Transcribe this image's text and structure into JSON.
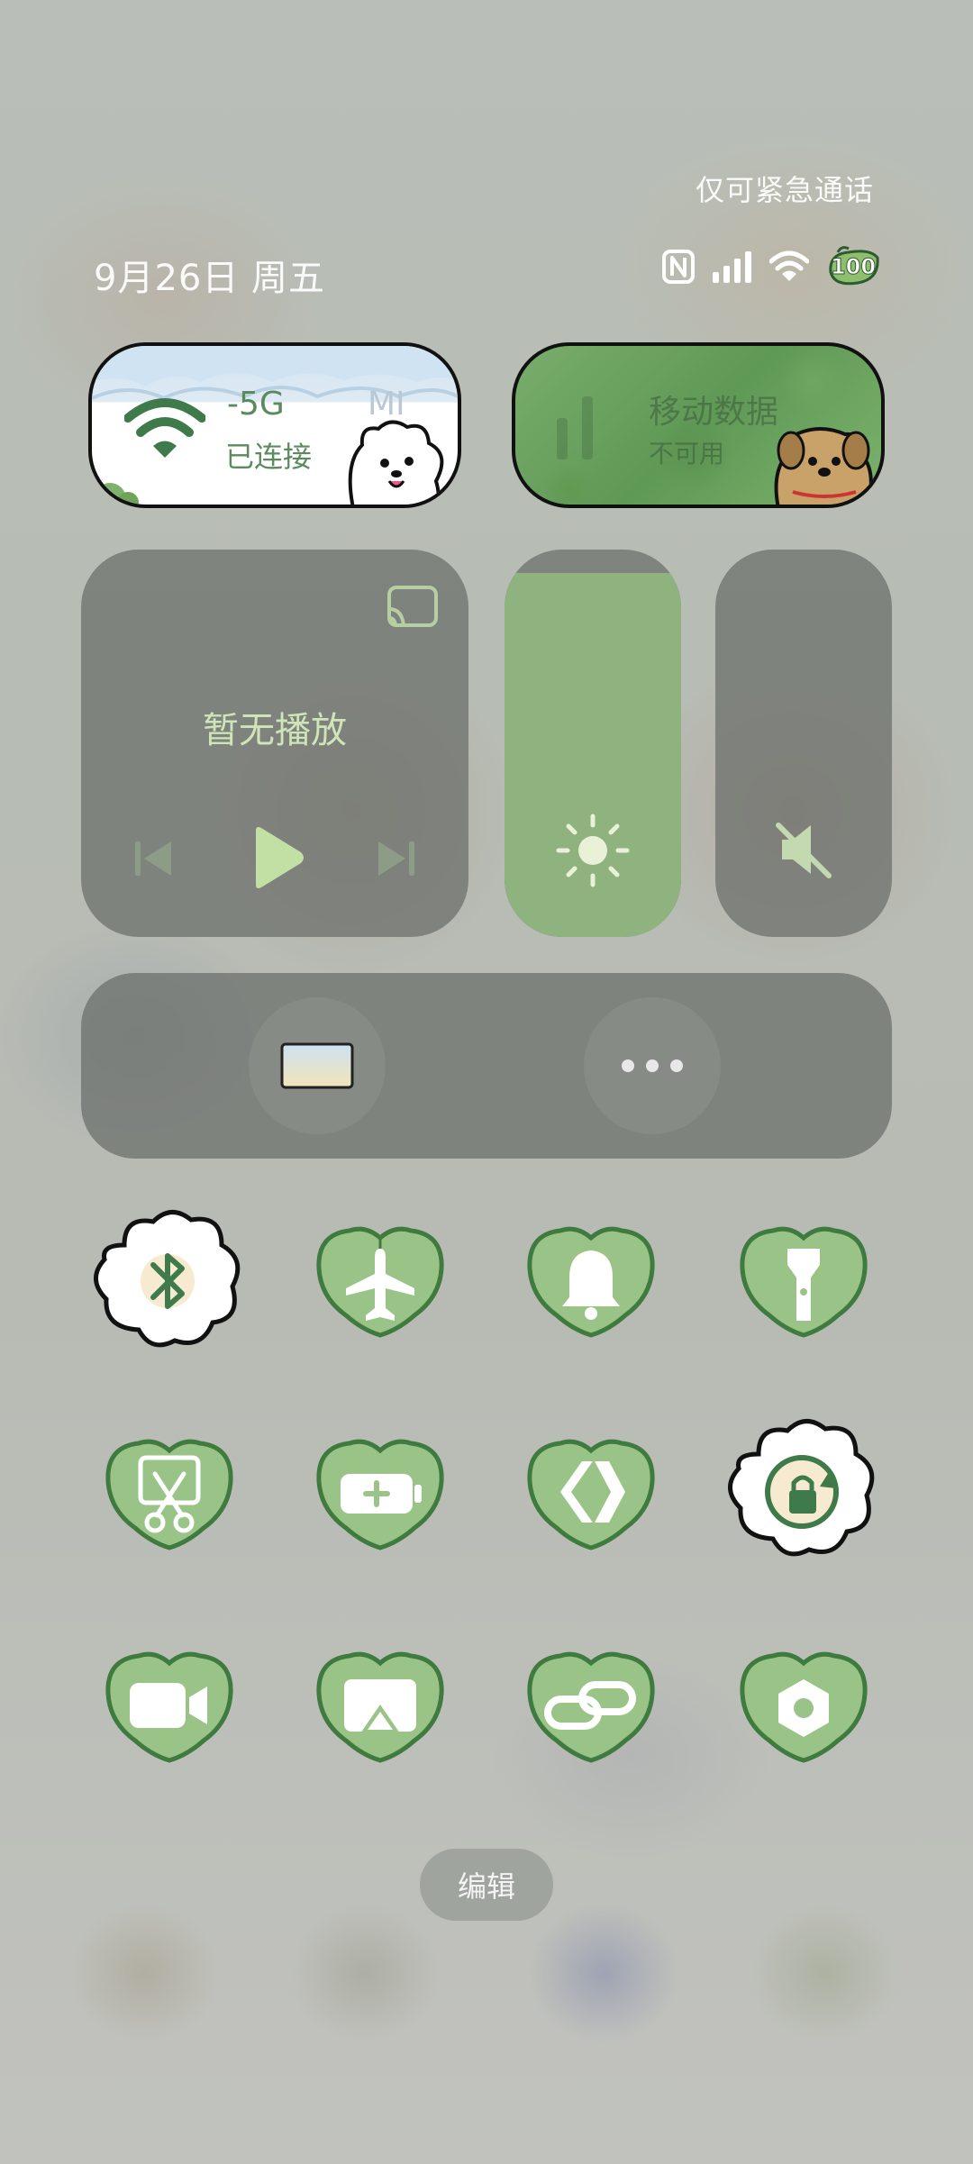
{
  "status": {
    "emergency_text": "仅可紧急通话",
    "date": "9月26日 周五",
    "battery_level": "100",
    "icons": [
      "nfc-icon",
      "signal-icon",
      "wifi-icon",
      "battery-icon"
    ]
  },
  "wifi_tile": {
    "network_name": "-5G",
    "network_trailing": "MI",
    "status": "已连接",
    "icon": "wifi-icon"
  },
  "data_tile": {
    "title": "移动数据",
    "status": "不可用"
  },
  "media": {
    "title": "暂无播放",
    "controls": [
      "previous-icon",
      "play-icon",
      "next-icon"
    ],
    "cast_icon": "cast-icon"
  },
  "brightness": {
    "level_fraction": 0.94,
    "icon": "sun-icon"
  },
  "volume": {
    "muted": true,
    "icon": "mute-icon"
  },
  "shortcuts": {
    "left_icon": "wallpaper-icon",
    "right_icon": "more-icon"
  },
  "toggles": [
    {
      "name": "bluetooth",
      "icon": "bluetooth-icon",
      "active": true
    },
    {
      "name": "airplane",
      "icon": "airplane-icon",
      "active": false
    },
    {
      "name": "ring",
      "icon": "bell-icon",
      "active": false
    },
    {
      "name": "flashlight",
      "icon": "flashlight-icon",
      "active": false
    },
    {
      "name": "screenshot",
      "icon": "scissors-icon",
      "active": false
    },
    {
      "name": "battery-saver",
      "icon": "battery-plus-icon",
      "active": false
    },
    {
      "name": "nearby-share",
      "icon": "share-icon",
      "active": false
    },
    {
      "name": "rotation-lock",
      "icon": "rotation-lock-icon",
      "active": true
    },
    {
      "name": "screen-record",
      "icon": "video-icon",
      "active": false
    },
    {
      "name": "screen-cast",
      "icon": "screen-cast-icon",
      "active": false
    },
    {
      "name": "link",
      "icon": "link-icon",
      "active": false
    },
    {
      "name": "settings",
      "icon": "hex-gear-icon",
      "active": false
    }
  ],
  "edit_label": "编辑",
  "colors": {
    "accent_green": "#8fb37f",
    "leaf_green": "#9ac487",
    "leaf_outline": "#3f7a3f",
    "text_light": "#cfe4b7"
  }
}
